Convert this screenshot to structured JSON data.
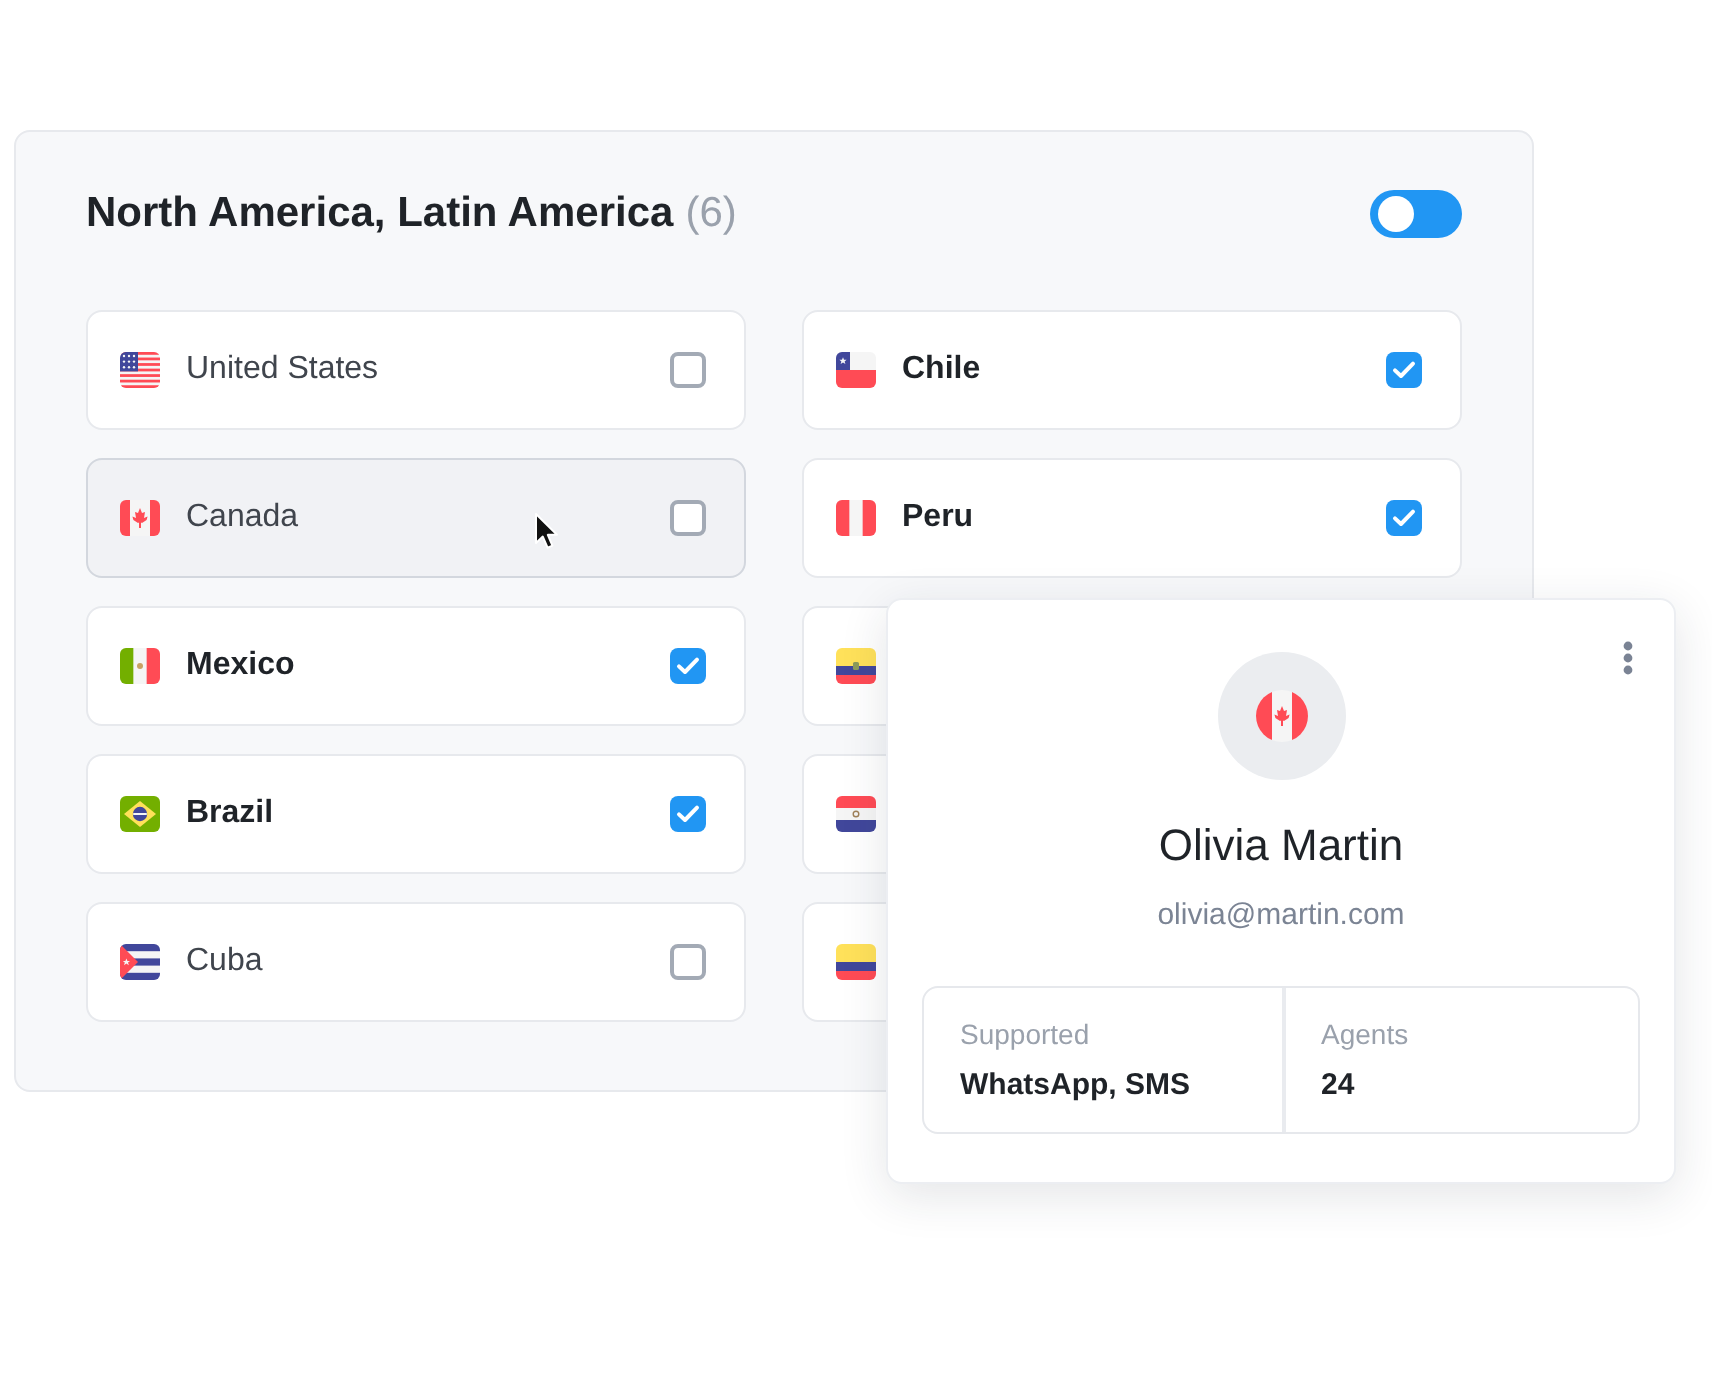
{
  "section": {
    "title": "North America, Latin America",
    "count": "(6)",
    "toggle": {
      "on": false
    }
  },
  "columns": [
    {
      "items": [
        {
          "label": "United States",
          "checked": false,
          "hovered": false
        },
        {
          "label": "Canada",
          "checked": false,
          "hovered": true
        },
        {
          "label": "Mexico",
          "checked": true,
          "hovered": false
        },
        {
          "label": "Brazil",
          "checked": true,
          "hovered": false
        },
        {
          "label": "Cuba",
          "checked": false,
          "hovered": false
        }
      ]
    },
    {
      "items": [
        {
          "label": "Chile",
          "checked": true,
          "hovered": false
        },
        {
          "label": "Peru",
          "checked": true,
          "hovered": false
        },
        {
          "hovered": false
        },
        {
          "hovered": false
        },
        {
          "hovered": false
        }
      ]
    }
  ],
  "profile_card": {
    "name": "Olivia Martin",
    "email": "olivia@martin.com",
    "stats": [
      {
        "label": "Supported",
        "value": "WhatsApp, SMS"
      },
      {
        "label": "Agents",
        "value": "24"
      }
    ]
  }
}
